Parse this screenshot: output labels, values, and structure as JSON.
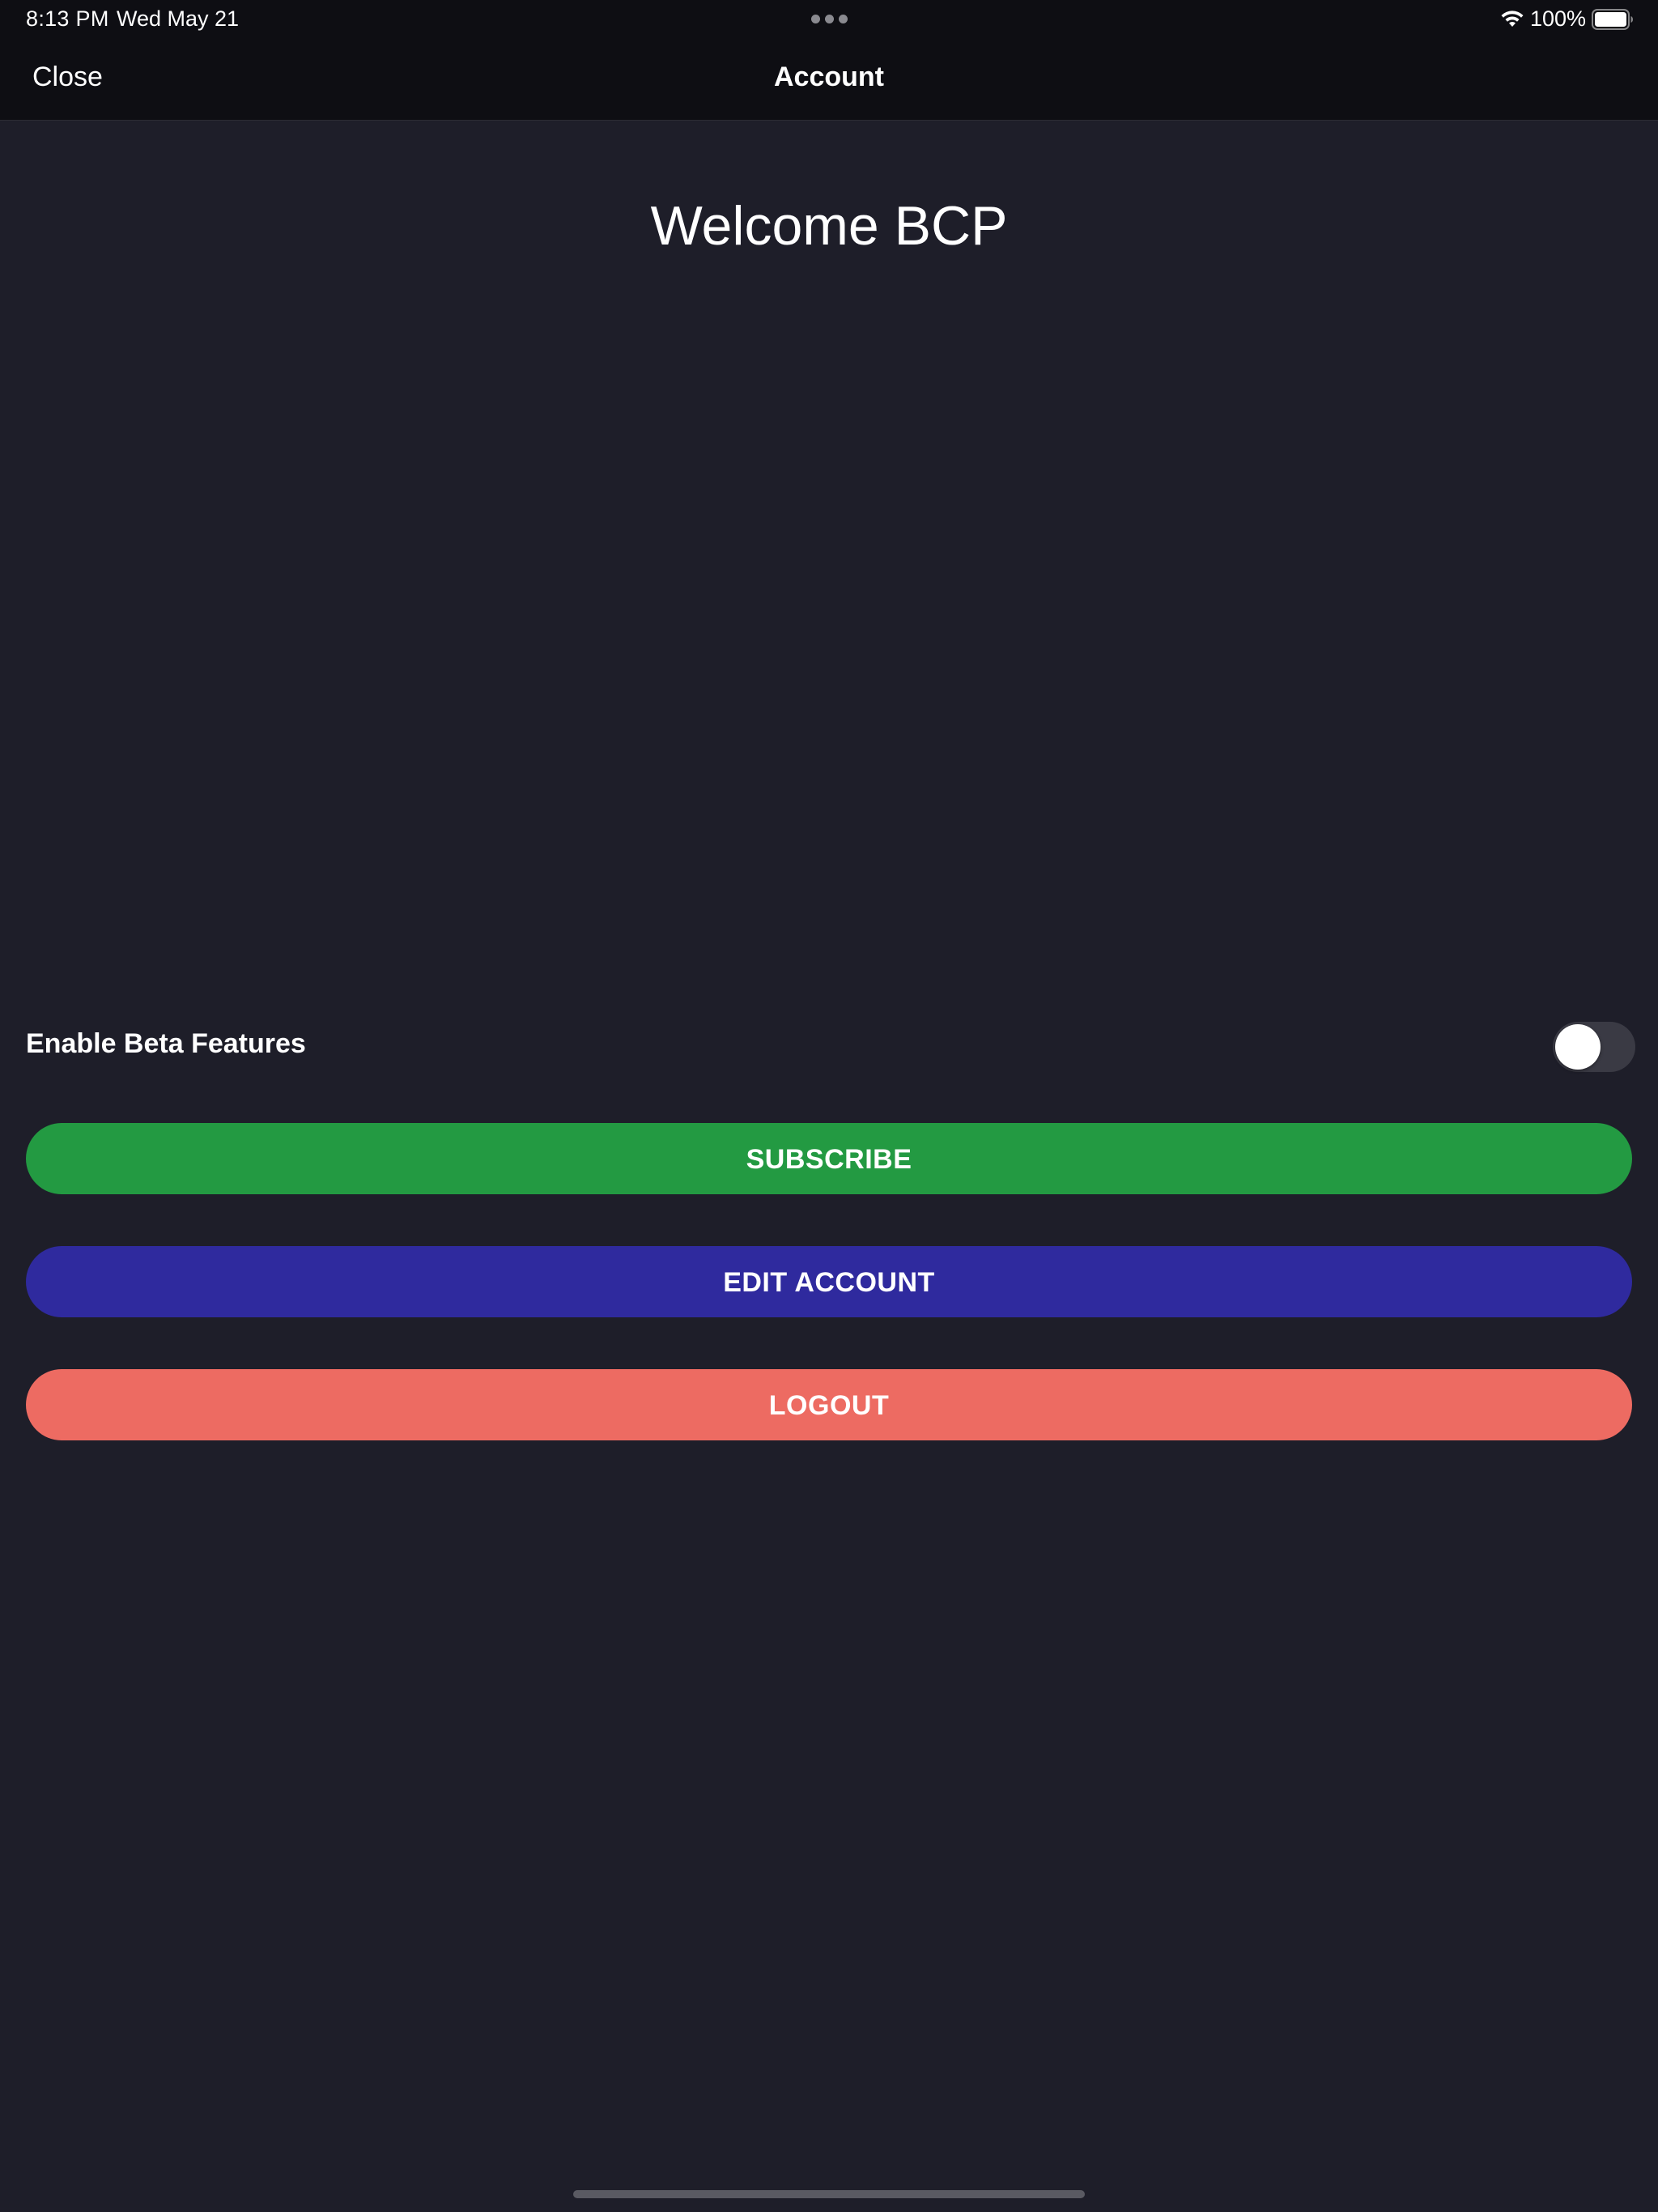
{
  "status_bar": {
    "time": "8:13 PM",
    "date": "Wed May 21",
    "battery_percent": "100%",
    "battery_level": 1.0,
    "icons": [
      "wifi-icon",
      "battery-icon",
      "multitask-dots-icon"
    ]
  },
  "nav": {
    "close_label": "Close",
    "title": "Account"
  },
  "main": {
    "welcome": "Welcome BCP",
    "beta_toggle": {
      "label": "Enable Beta Features",
      "enabled": false
    },
    "buttons": {
      "subscribe": "SUBSCRIBE",
      "edit_account": "EDIT ACCOUNT",
      "logout": "LOGOUT"
    }
  },
  "colors": {
    "background": "#1e1e29",
    "bar_background": "#0e0e13",
    "subscribe": "#239a42",
    "edit_account": "#2f2a9e",
    "logout": "#ed6b62",
    "toggle_off": "#3a3a44"
  }
}
